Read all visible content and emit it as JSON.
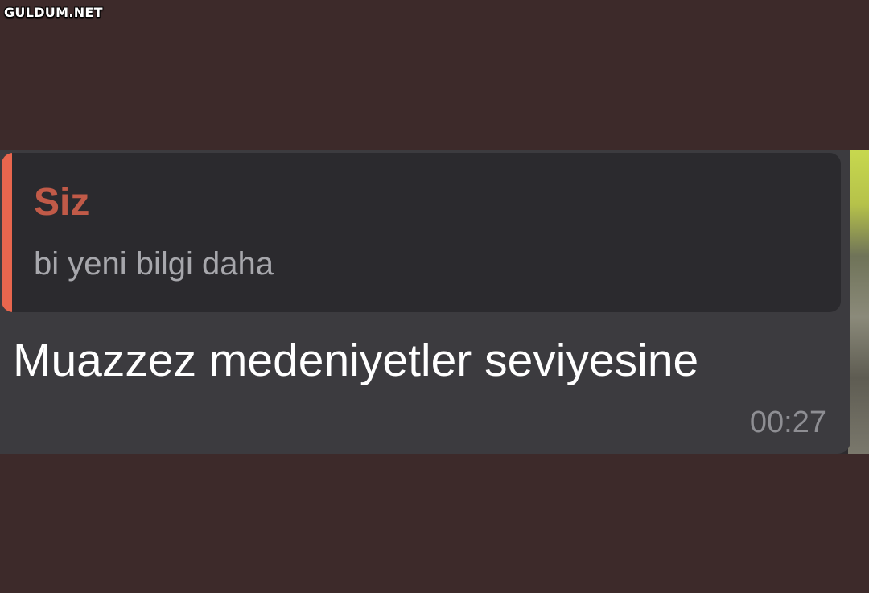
{
  "watermark": "GULDUM.NET",
  "message": {
    "reply": {
      "sender": "Siz",
      "text": "bi yeni bilgi daha"
    },
    "text": "Muazzez medeniyetler seviyesine",
    "time": "00:27"
  },
  "colors": {
    "page_background": "#3d2a2a",
    "bubble": "#3c3b3f",
    "quote_background": "#2b2a2e",
    "quote_accent": "#e8664e",
    "quote_sender": "#c15a48"
  }
}
